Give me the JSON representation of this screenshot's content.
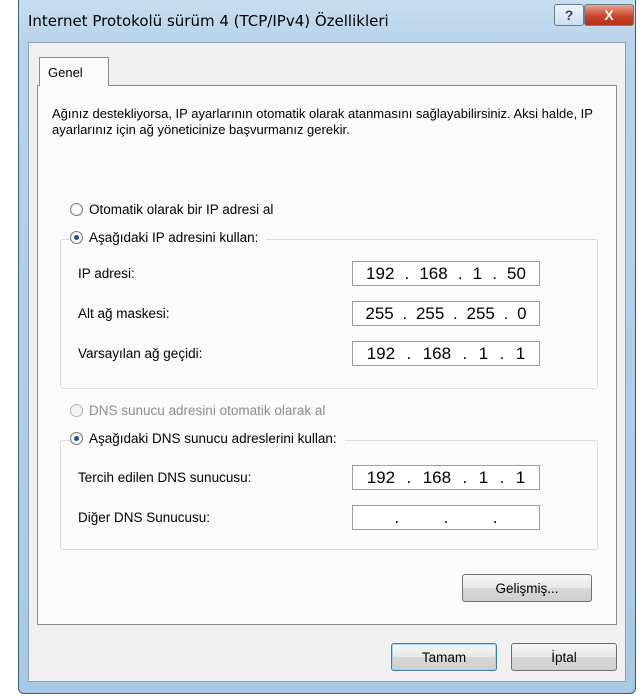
{
  "window": {
    "title": "Internet Protokolü sürüm 4 (TCP/IPv4) Özellikleri",
    "help_glyph": "?",
    "close_glyph": "X"
  },
  "tab": {
    "label": "Genel"
  },
  "description": "Ağınız destekliyorsa, IP ayarlarının otomatik olarak atanmasını sağlayabilirsiniz. Aksi halde, IP ayarlarınız için ağ yöneticinize başvurmanız gerekir.",
  "ip_section": {
    "auto_label": "Otomatik olarak bir IP adresi al",
    "manual_label": "Aşağıdaki IP adresini kullan:",
    "selected": "manual",
    "fields": [
      {
        "label": "IP adresi:",
        "octets": [
          "192",
          "168",
          "1",
          "50"
        ]
      },
      {
        "label": "Alt ağ maskesi:",
        "octets": [
          "255",
          "255",
          "255",
          "0"
        ]
      },
      {
        "label": "Varsayılan ağ geçidi:",
        "octets": [
          "192",
          "168",
          "1",
          "1"
        ]
      }
    ]
  },
  "dns_section": {
    "auto_label": "DNS sunucu adresini otomatik olarak al",
    "manual_label": "Aşağıdaki DNS sunucu adreslerini kullan:",
    "selected": "manual",
    "fields": [
      {
        "label": "Tercih edilen DNS sunucusu:",
        "octets": [
          "192",
          "168",
          "1",
          "1"
        ]
      },
      {
        "label": "Diğer DNS Sunucusu:",
        "octets": [
          "",
          "",
          "",
          ""
        ]
      }
    ]
  },
  "buttons": {
    "advanced": "Gelişmiş...",
    "ok": "Tamam",
    "cancel": "İptal"
  }
}
